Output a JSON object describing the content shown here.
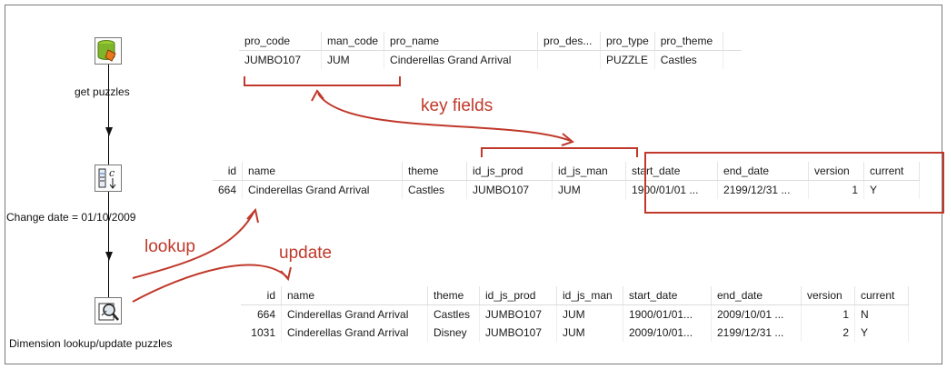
{
  "steps": {
    "get_puzzles": {
      "label": "get puzzles",
      "icon": "database-icon"
    },
    "change_date": {
      "label": "Change date = 01/10/2009",
      "icon": "calculator-icon"
    },
    "dimension": {
      "label": "Dimension lookup/update puzzles",
      "icon": "lookup-icon"
    }
  },
  "source_table": {
    "headers": [
      "pro_code",
      "man_code",
      "pro_name",
      "pro_des...",
      "pro_type",
      "pro_theme"
    ],
    "rows": [
      [
        "JUMBO107",
        "JUM",
        "Cinderellas Grand Arrival",
        "",
        "PUZZLE",
        "Castles"
      ]
    ]
  },
  "lookup_table": {
    "headers": [
      "id",
      "name",
      "theme",
      "id_js_prod",
      "id_js_man",
      "start_date",
      "end_date",
      "version",
      "current"
    ],
    "rows": [
      [
        "664",
        "Cinderellas Grand Arrival",
        "Castles",
        "JUMBO107",
        "JUM",
        "1900/01/01 ...",
        "2199/12/31 ...",
        "1",
        "Y"
      ]
    ]
  },
  "update_table": {
    "headers": [
      "id",
      "name",
      "theme",
      "id_js_prod",
      "id_js_man",
      "start_date",
      "end_date",
      "version",
      "current"
    ],
    "rows": [
      [
        "664",
        "Cinderellas Grand Arrival",
        "Castles",
        "JUMBO107",
        "JUM",
        "1900/01/01...",
        "2009/10/01 ...",
        "1",
        "N"
      ],
      [
        "1031",
        "Cinderellas Grand Arrival",
        "Disney",
        "JUMBO107",
        "JUM",
        "2009/10/01...",
        "2199/12/31 ...",
        "2",
        "Y"
      ]
    ]
  },
  "annotations": {
    "key_fields": "key fields",
    "lookup": "lookup",
    "update": "update"
  },
  "colors": {
    "annotation": "#c0392b",
    "frame": "#7a7a7a"
  }
}
